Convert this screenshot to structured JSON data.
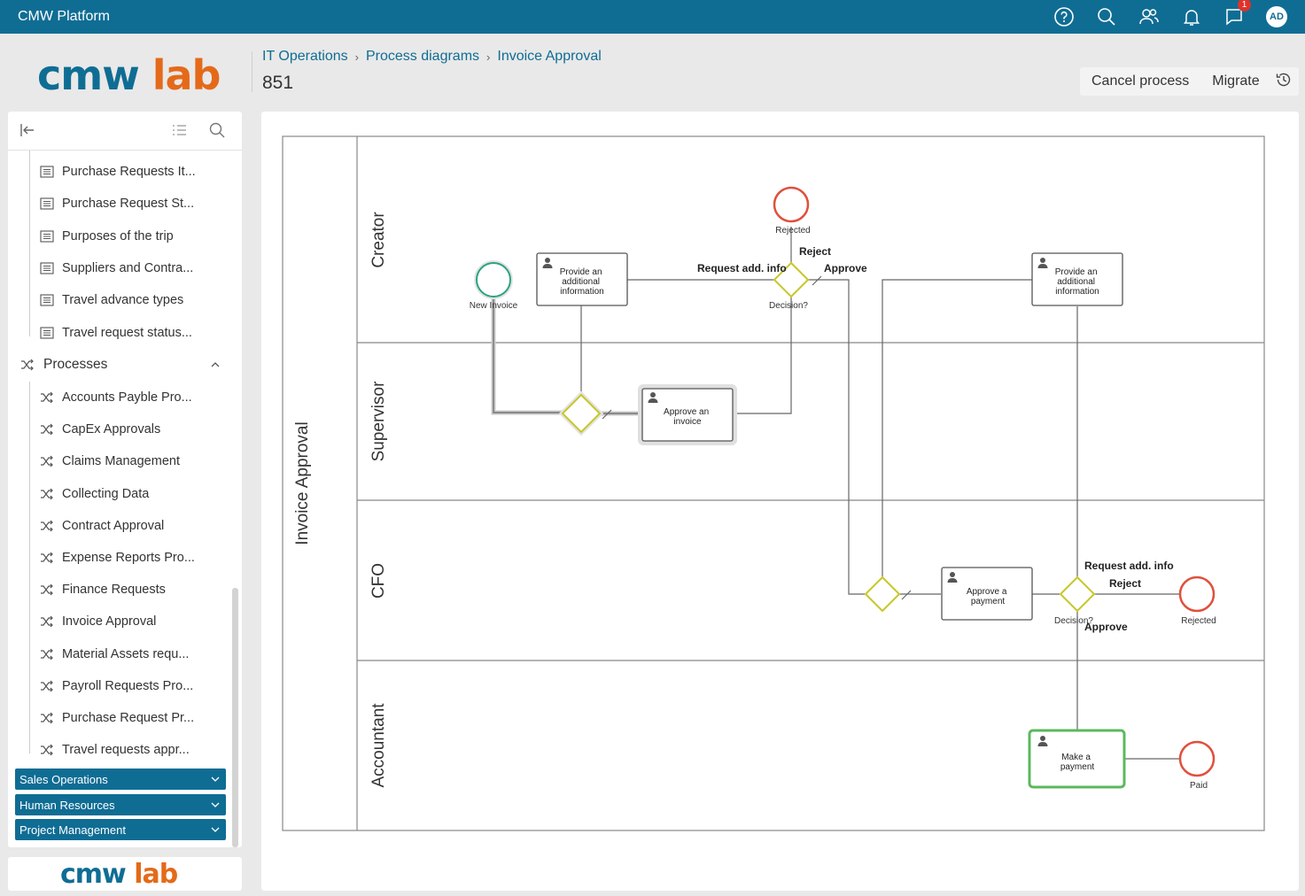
{
  "app": {
    "title": "CMW Platform",
    "notification_count": "1",
    "avatar_initials": "AD"
  },
  "logo": {
    "part1": "cmw",
    "part2": "lab"
  },
  "breadcrumb": {
    "items": [
      "IT Operations",
      "Process diagrams",
      "Invoice Approval"
    ]
  },
  "page_id": "851",
  "actions": {
    "cancel": "Cancel process",
    "migrate": "Migrate"
  },
  "sidebar": {
    "tables": [
      "Purchase Requests It...",
      "Purchase Request St...",
      "Purposes of the trip",
      "Suppliers and Contra...",
      "Travel advance types",
      "Travel request status..."
    ],
    "processes_label": "Processes",
    "processes": [
      "Accounts Payble Pro...",
      "CapEx Approvals",
      "Claims Management",
      "Collecting Data",
      "Contract Approval",
      "Expense Reports Pro...",
      "Finance Requests",
      "Invoice Approval",
      "Material Assets requ...",
      "Payroll Requests Pro...",
      "Purchase Request Pr...",
      "Travel requests appr..."
    ],
    "sections": [
      "Sales Operations",
      "Human Resources",
      "Project Management"
    ]
  },
  "diagram": {
    "pool": "Invoice Approval",
    "lanes": [
      "Creator",
      "Supervisor",
      "CFO",
      "Accountant"
    ],
    "events": {
      "start": "New Invoice",
      "rejected1": "Rejected",
      "rejected2": "Rejected",
      "paid": "Paid"
    },
    "tasks": {
      "provide1": [
        "Provide an",
        "additional",
        "information"
      ],
      "provide2": [
        "Provide an",
        "additional",
        "information"
      ],
      "approve_invoice": [
        "Approve an",
        "invoice"
      ],
      "approve_payment": [
        "Approve a",
        "payment"
      ],
      "make_payment": [
        "Make a",
        "payment"
      ]
    },
    "gateways": {
      "decision1": "Decision?",
      "decision2": "Decision?"
    },
    "flows": {
      "request_info1": "Request add. info",
      "reject1": "Reject",
      "approve1": "Approve",
      "request_info2": "Request add. info",
      "reject2": "Reject",
      "approve2": "Approve"
    }
  },
  "colors": {
    "brand": "#0f6d94",
    "accent": "#e46a1a",
    "gateway": "#c7c72a",
    "start": "#2aa37f",
    "end": "#e0503c",
    "active_task": "#5cb85c"
  }
}
